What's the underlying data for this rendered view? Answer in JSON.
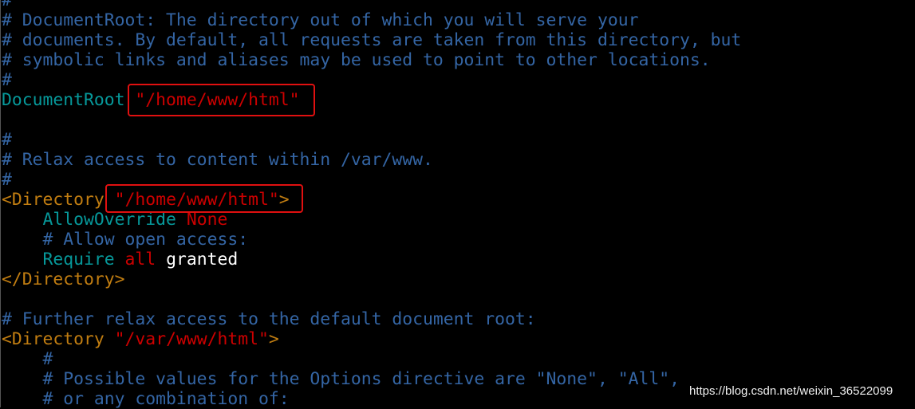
{
  "colors": {
    "comment": "#3465a4",
    "keyword": "#06989a",
    "string": "#cc0000",
    "tag": "#c17d11",
    "plain": "#ffffff",
    "highlight_box": "#e01010"
  },
  "lines": [
    [
      {
        "t": "#",
        "c": "comment"
      }
    ],
    [
      {
        "t": "# DocumentRoot: The directory out of which you will serve your",
        "c": "comment"
      }
    ],
    [
      {
        "t": "# documents. By default, all requests are taken from this directory, but",
        "c": "comment"
      }
    ],
    [
      {
        "t": "# symbolic links and aliases may be used to point to other locations.",
        "c": "comment"
      }
    ],
    [
      {
        "t": "#",
        "c": "comment"
      }
    ],
    [
      {
        "t": "DocumentRoot",
        "c": "keyword"
      },
      {
        "t": " \"/home/www/html\"",
        "c": "string"
      }
    ],
    [],
    [
      {
        "t": "#",
        "c": "comment"
      }
    ],
    [
      {
        "t": "# Relax access to content within /var/www.",
        "c": "comment"
      }
    ],
    [
      {
        "t": "#",
        "c": "comment"
      }
    ],
    [
      {
        "t": "<Directory",
        "c": "tag"
      },
      {
        "t": " \"/home/www/html\"",
        "c": "string"
      },
      {
        "t": ">",
        "c": "tag"
      }
    ],
    [
      {
        "t": "    AllowOverride",
        "c": "keyword"
      },
      {
        "t": " None",
        "c": "string"
      }
    ],
    [
      {
        "t": "    # Allow open access:",
        "c": "comment"
      }
    ],
    [
      {
        "t": "    Require",
        "c": "keyword"
      },
      {
        "t": " all",
        "c": "string"
      },
      {
        "t": " granted",
        "c": "plain"
      }
    ],
    [
      {
        "t": "</Directory>",
        "c": "tag"
      }
    ],
    [],
    [
      {
        "t": "# Further relax access to the default document root:",
        "c": "comment"
      }
    ],
    [
      {
        "t": "<Directory",
        "c": "tag"
      },
      {
        "t": " \"/var/www/html\"",
        "c": "string"
      },
      {
        "t": ">",
        "c": "tag"
      }
    ],
    [
      {
        "t": "    #",
        "c": "comment"
      }
    ],
    [
      {
        "t": "    # Possible values for the Options directive are \"None\", \"All\",",
        "c": "comment"
      }
    ],
    [
      {
        "t": "    # or any combination of:",
        "c": "comment"
      }
    ]
  ],
  "watermark": "https://blog.csdn.net/weixin_36522099"
}
